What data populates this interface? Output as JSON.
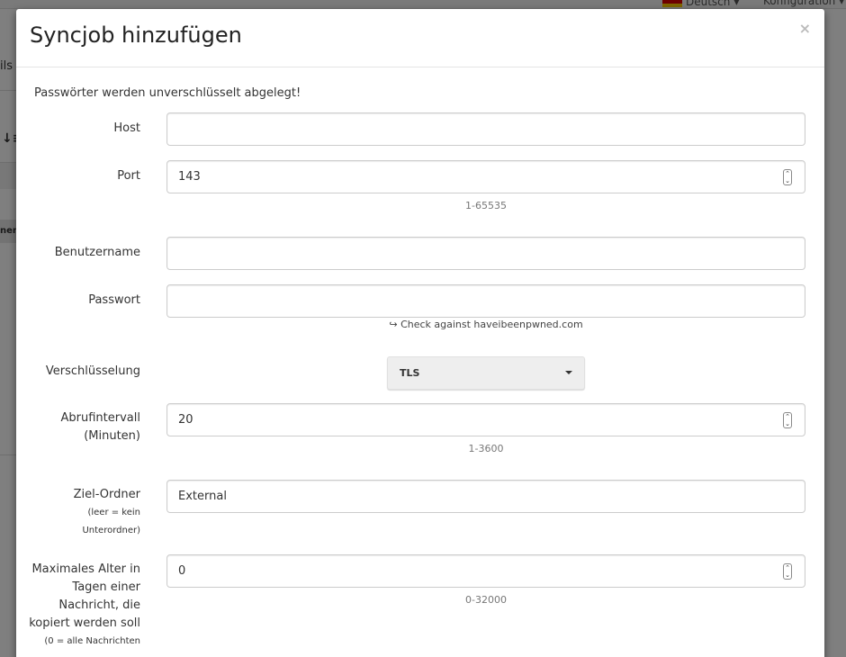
{
  "background": {
    "language": "Deutsch",
    "config": "Konfiguration",
    "partial_text": "ils",
    "partial_tab": "nen"
  },
  "modal": {
    "title": "Syncjob hinzufügen",
    "close": "×",
    "notice": "Passwörter werden unverschlüsselt abgelegt!",
    "fields": {
      "host": {
        "label": "Host",
        "value": ""
      },
      "port": {
        "label": "Port",
        "value": "143",
        "hint": "1-65535"
      },
      "username": {
        "label": "Benutzername",
        "value": ""
      },
      "password": {
        "label": "Passwort",
        "value": "",
        "pwned_link": "Check against haveibeenpwned.com"
      },
      "encryption": {
        "label": "Verschlüsselung",
        "selected": "TLS"
      },
      "interval": {
        "label_line1": "Abrufintervall",
        "label_line2": "(Minuten)",
        "value": "20",
        "hint": "1-3600"
      },
      "target_folder": {
        "label": "Ziel-Ordner",
        "sub1": "(leer = kein",
        "sub2": "Unterordner)",
        "value": "External"
      },
      "max_age": {
        "label_line1": "Maximales Alter in",
        "label_line2": "Tagen einer",
        "label_line3": "Nachricht, die",
        "label_line4": "kopiert werden soll",
        "sub1": "(0 = alle Nachrichten",
        "value": "0",
        "hint": "0-32000"
      }
    }
  }
}
